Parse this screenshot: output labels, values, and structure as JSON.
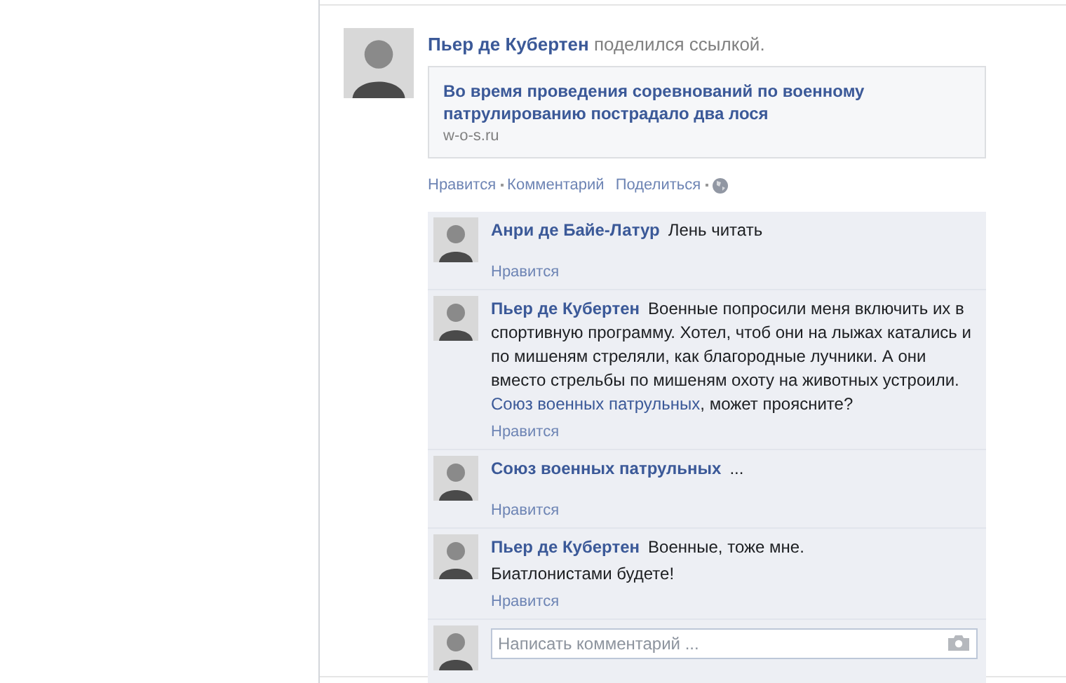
{
  "post": {
    "author": "Пьер де Кубертен",
    "action": "поделился ссылкой.",
    "link": {
      "title": "Во время проведения соревнований по военному патрулированию пострадало два лося",
      "domain": "w-o-s.ru"
    },
    "actions": [
      "Нравится",
      "Комментарий",
      "Поделиться"
    ]
  },
  "comments": [
    {
      "kind": "comment",
      "author": "Анри де Байе-Латур",
      "text": "Лень читать",
      "like": "Нравится"
    },
    {
      "kind": "comment",
      "author": "Пьер де Кубертен",
      "text": "Военные попросили меня включить их в спортивную программу. Хотел, чтоб они на лыжах катались и по мишеням стреляли, как благородные лучники. А они вместо стрельбы по мишеням охоту на животных устроили.",
      "mention": "Союз военных патрульных",
      "mention_rest": ", может проясните?",
      "like": "Нравится"
    },
    {
      "kind": "comment",
      "author": "Союз военных патрульных",
      "text": "...",
      "like": "Нравится"
    },
    {
      "kind": "comment",
      "author": "Пьер де Кубертен",
      "text": "Военные, тоже мне.",
      "text_line2": "Биатлонистами будете!",
      "like": "Нравится"
    },
    {
      "kind": "composer",
      "placeholder": "Написать комментарий ..."
    }
  ]
}
